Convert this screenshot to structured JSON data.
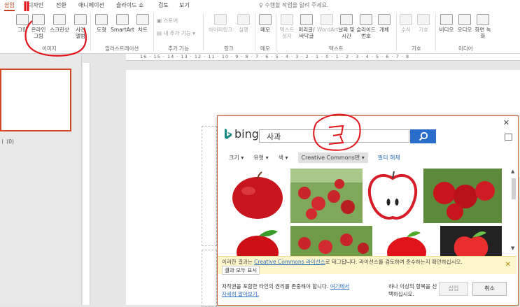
{
  "tabs": [
    "삽입",
    "디자인",
    "전환",
    "애니메이션",
    "슬라이드 쇼",
    "검토",
    "보기"
  ],
  "tell_me": "수행할 작업을 알려 주세요.",
  "ribbon": {
    "buttons": [
      {
        "label": "그림"
      },
      {
        "label": "온라인 그림"
      },
      {
        "label": "스크린샷"
      },
      {
        "label": "사진 앨범"
      },
      {
        "label": "도형"
      },
      {
        "label": "SmartArt"
      },
      {
        "label": "차트"
      },
      {
        "label": "스토어"
      },
      {
        "label": "내 추가 기능"
      },
      {
        "label": "하이퍼링크"
      },
      {
        "label": "실행"
      },
      {
        "label": "메모"
      },
      {
        "label": "텍스트 상자"
      },
      {
        "label": "머리글/바닥글"
      },
      {
        "label": "WordArt"
      },
      {
        "label": "날짜 및 시간"
      },
      {
        "label": "슬라이드 번호"
      },
      {
        "label": "개체"
      },
      {
        "label": "수식"
      },
      {
        "label": "기호"
      },
      {
        "label": "비디오"
      },
      {
        "label": "오디오"
      },
      {
        "label": "화면 녹화"
      }
    ],
    "groups": [
      "이미지",
      "일러스트레이션",
      "추가 기능",
      "링크",
      "메모",
      "텍스트",
      "기호",
      "미디어"
    ]
  },
  "left_panel": {
    "caption": "ㅣ (0)"
  },
  "ruler_marks": "16 · 15 · 14 · 13 · 12 · 11 · 10 · 9 · 8 · 7 · 6 · 5 · 4 · 3 · 2 · 1 · 0 · 1 · 2 · 3 · 4 · 5 · 6 · 7 · 8",
  "dialog": {
    "brand": "bing",
    "search_value": "사과",
    "filters": {
      "size": "크기",
      "type": "유형",
      "color": "색",
      "license": "Creative Commons만",
      "clear": "필터 해제"
    },
    "cc_notice": {
      "before": "이러한 결과는 ",
      "link": "Creative Commons 라이선스",
      "after": "로 태그됩니다. 라이선스를 검토하여 준수하는지 확인하십시오.",
      "show_all": "결과 모두 표시"
    },
    "footer_text": "저작권을 포함한 타인의 권리를 존중해야 합니다. ",
    "footer_link1": "여기에서",
    "footer_link2": "자세히 알아보기.",
    "selection_note": "하나 이상의 항목을 선택하십시오.",
    "insert_label": "삽입",
    "cancel_label": "취소"
  },
  "colors": {
    "accent": "#c43e1c",
    "search_button": "#2b6ec9",
    "notice_bg": "#fff7cc"
  }
}
